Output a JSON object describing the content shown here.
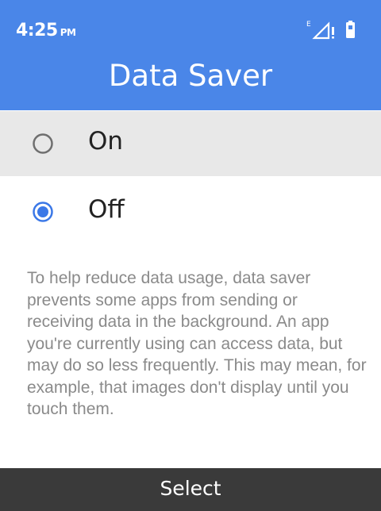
{
  "status": {
    "time": "4:25",
    "ampm": "PM",
    "network_label": "E",
    "icons": [
      "signal-icon",
      "battery-icon"
    ]
  },
  "header": {
    "title": "Data Saver"
  },
  "options": [
    {
      "label": "On",
      "selected": false,
      "focused": true
    },
    {
      "label": "Off",
      "selected": true,
      "focused": false
    }
  ],
  "description": "To help reduce data usage, data saver prevents some apps from sending or receiving data in the background. An app you're currently using can access data, but may do so less frequently. This may mean, for example, that images don't display until you touch them.",
  "softkey": {
    "center_label": "Select"
  },
  "colors": {
    "accent": "#4a86e8",
    "softkey_bg": "#3a3a3a",
    "focus_bg": "#e8e8e8"
  }
}
